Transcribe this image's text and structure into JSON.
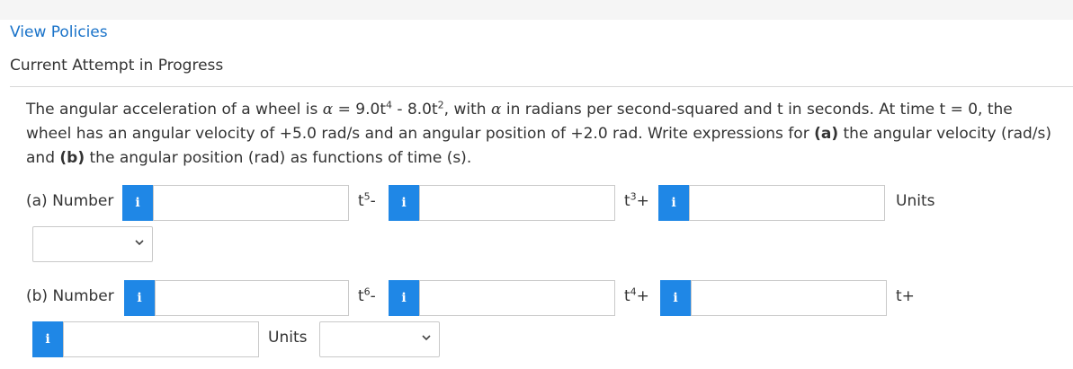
{
  "header": {
    "view_policies": "View Policies",
    "attempt_title": "Current Attempt in Progress"
  },
  "question": {
    "s1": "The angular acceleration of a wheel is ",
    "alpha1": "α",
    "s2": " = 9.0t",
    "exp1": "4",
    "s3": " - 8.0t",
    "exp2": "2",
    "s4": ", with ",
    "alpha2": "α",
    "s5": " in radians per second-squared and t in seconds. At time t = 0, the wheel has an angular velocity of +5.0 rad/s and an angular position of +2.0 rad. Write expressions for ",
    "a": "(a)",
    "s6": " the angular velocity (rad/s) and ",
    "b": "(b)",
    "s7": " the angular position (rad) as functions of time (s)."
  },
  "part_a": {
    "label": "(a) Number",
    "term1_base": "t",
    "term1_exp": "5",
    "term1_op": "-",
    "term2_base": "t",
    "term2_exp": "3",
    "term2_op": "+",
    "units_label": "Units",
    "inputs": [
      "",
      "",
      ""
    ],
    "units_value": ""
  },
  "part_b": {
    "label": "(b) Number",
    "term1_base": "t",
    "term1_exp": "6",
    "term1_op": "-",
    "term2_base": "t",
    "term2_exp": "4",
    "term2_op": "+",
    "term3": "t+",
    "units_label": "Units",
    "inputs": [
      "",
      "",
      "",
      ""
    ],
    "units_value": ""
  },
  "icons": {
    "info": "i",
    "chevron": "⌄"
  },
  "colors": {
    "link": "#1a73c9",
    "info_button": "#1f87e6",
    "text": "#333333",
    "input_border": "#c9c9c9"
  }
}
